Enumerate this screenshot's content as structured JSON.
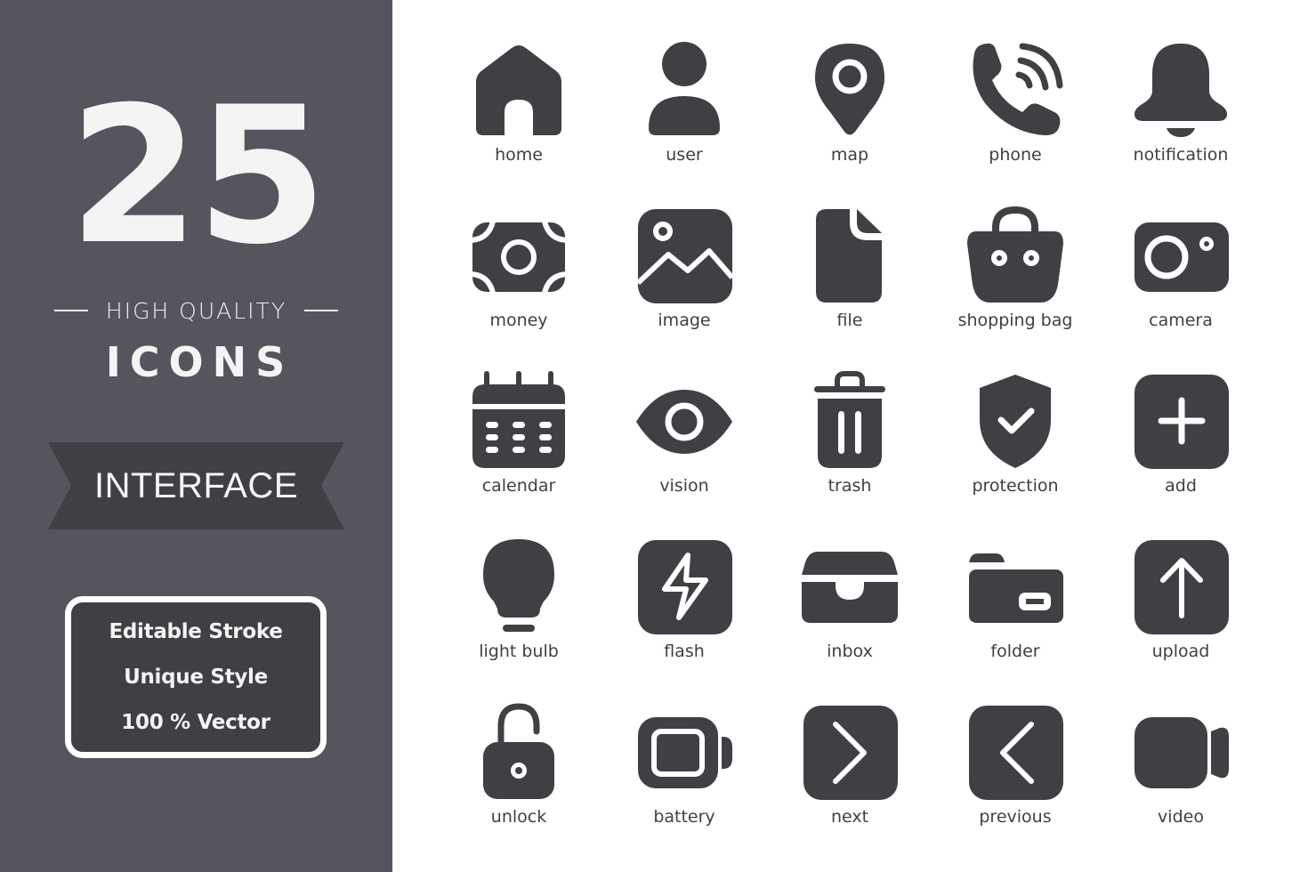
{
  "colors": {
    "panel_bg": "#55555d",
    "icon_fill": "#3f3f44",
    "text_light": "#f4f4f4",
    "page_bg": "#ffffff"
  },
  "promo": {
    "count": "25",
    "subtitle": "HIGH QUALITY",
    "title": "ICONS",
    "category": "INTERFACE",
    "features": [
      "Editable Stroke",
      "Unique Style",
      "100 % Vector"
    ]
  },
  "icons": [
    {
      "name": "home",
      "label": "home"
    },
    {
      "name": "user",
      "label": "user"
    },
    {
      "name": "map",
      "label": "map"
    },
    {
      "name": "phone",
      "label": "phone"
    },
    {
      "name": "notification",
      "label": "notification"
    },
    {
      "name": "money",
      "label": "money"
    },
    {
      "name": "image",
      "label": "image"
    },
    {
      "name": "file",
      "label": "file"
    },
    {
      "name": "shopping-bag",
      "label": "shopping bag"
    },
    {
      "name": "camera",
      "label": "camera"
    },
    {
      "name": "calendar",
      "label": "calendar"
    },
    {
      "name": "vision",
      "label": "vision"
    },
    {
      "name": "trash",
      "label": "trash"
    },
    {
      "name": "protection",
      "label": "protection"
    },
    {
      "name": "add",
      "label": "add"
    },
    {
      "name": "light-bulb",
      "label": "light bulb"
    },
    {
      "name": "flash",
      "label": "flash"
    },
    {
      "name": "inbox",
      "label": "inbox"
    },
    {
      "name": "folder",
      "label": "folder"
    },
    {
      "name": "upload",
      "label": "upload"
    },
    {
      "name": "unlock",
      "label": "unlock"
    },
    {
      "name": "battery",
      "label": "battery"
    },
    {
      "name": "next",
      "label": "next"
    },
    {
      "name": "previous",
      "label": "previous"
    },
    {
      "name": "video",
      "label": "video"
    }
  ]
}
